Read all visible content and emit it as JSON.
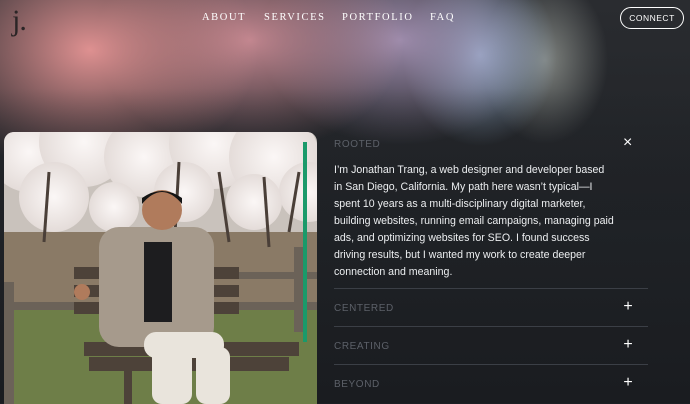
{
  "header": {
    "logo": "j.",
    "nav": [
      "ABOUT",
      "SERVICES",
      "PORTFOLIO",
      "FAQ"
    ],
    "cta_label": "CONNECT"
  },
  "hero": {
    "photo_alt": "Man sitting on a wooden bench under cherry blossom trees"
  },
  "accordion": {
    "open": {
      "title": "ROOTED",
      "close_icon": "×",
      "body": "I’m Jonathan Trang, a web designer and developer based in San Diego, California. My path here wasn’t typical—I spent 10 years as a multi-disciplinary digital marketer, building websites, running email campaigns, managing paid ads, and optimizing websites for SEO. I found success driving results, but I wanted my work to create deeper connection and meaning."
    },
    "items": [
      {
        "title": "CENTERED",
        "icon": "+"
      },
      {
        "title": "CREATING",
        "icon": "+"
      },
      {
        "title": "BEYOND",
        "icon": "+"
      }
    ]
  },
  "colors": {
    "accent_pink": "#e8969a",
    "accent_blue": "#96afcd",
    "background": "#1c1f24",
    "text": "#ffffff"
  }
}
